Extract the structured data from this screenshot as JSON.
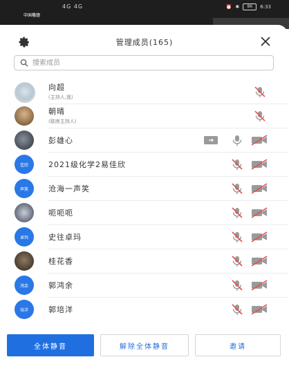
{
  "status_bar": {
    "carrier1": "中国移动",
    "carrier2": "中国电信",
    "signal": "4G 4G",
    "battery": "86",
    "time": "6:33"
  },
  "header": {
    "title": "管理成员(165)"
  },
  "search": {
    "placeholder": "搜索成员"
  },
  "members": [
    {
      "name": "向超",
      "role": "(主持人,我)",
      "avatar": "photo",
      "icons": [
        "mic-muted"
      ]
    },
    {
      "name": "朝晴",
      "role": "(联席主持人)",
      "avatar": "photo",
      "icons": [
        "mic-muted"
      ]
    },
    {
      "name": "彭雄心",
      "role": "",
      "avatar": "photo",
      "icons": [
        "screen-share",
        "mic",
        "camera-off"
      ]
    },
    {
      "name": "2021级化学2易佳欣",
      "role": "",
      "avatar": "佳欣",
      "icons": [
        "mic-muted",
        "camera-off"
      ]
    },
    {
      "name": "沧海一声笑",
      "role": "",
      "avatar": "声笑",
      "icons": [
        "mic-muted",
        "camera-off"
      ]
    },
    {
      "name": "呃呃呃",
      "role": "",
      "avatar": "photo",
      "icons": [
        "mic-muted",
        "camera-off"
      ]
    },
    {
      "name": "史往卓玛",
      "role": "",
      "avatar": "卓玛",
      "icons": [
        "mic-muted",
        "camera-off"
      ]
    },
    {
      "name": "桂花香",
      "role": "",
      "avatar": "photo",
      "icons": [
        "mic-muted",
        "camera-off"
      ]
    },
    {
      "name": "郭鸿余",
      "role": "",
      "avatar": "鸿余",
      "icons": [
        "mic-muted",
        "camera-off"
      ]
    },
    {
      "name": "郭培洋",
      "role": "",
      "avatar": "培洋",
      "icons": [
        "mic-muted",
        "camera-off"
      ]
    }
  ],
  "footer": {
    "mute_all": "全体静音",
    "unmute_all": "解除全体静音",
    "invite": "邀请"
  },
  "colors": {
    "accent": "#1f6fe0",
    "muted_red": "#d9534f",
    "icon_gray": "#8a8a8a"
  }
}
